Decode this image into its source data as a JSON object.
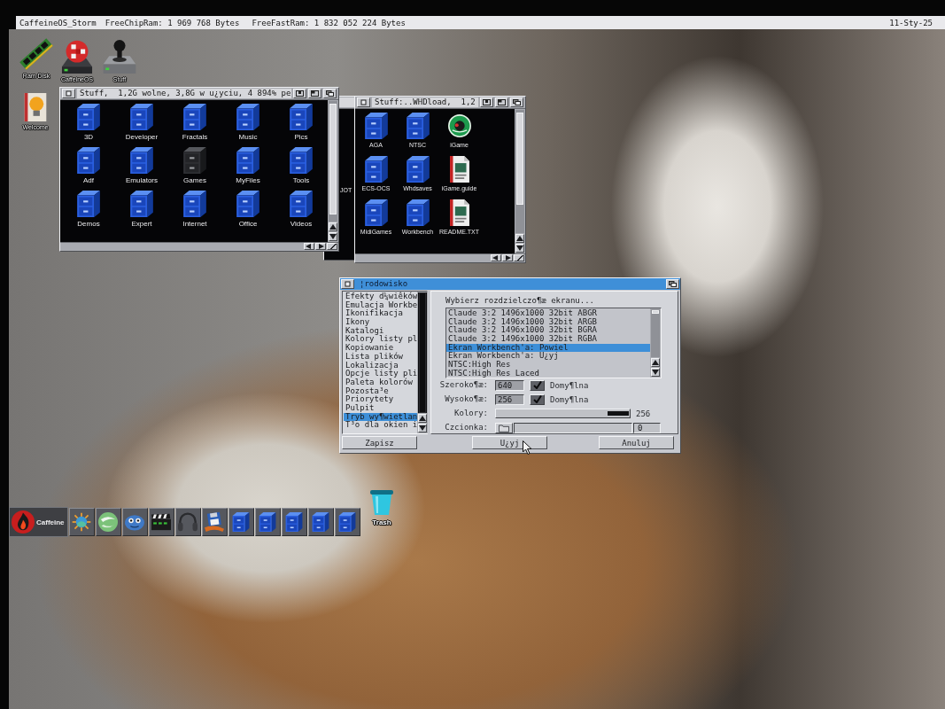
{
  "screen_bar": {
    "title": "CaffeineOS_Storm",
    "chip_ram": "FreeChipRam: 1 969 768 Bytes",
    "fast_ram": "FreeFastRam: 1 832 052 224 Bytes",
    "date": "11-Sty-25"
  },
  "desktop_icons": [
    {
      "label": "Ram Disk",
      "kind": "ram"
    },
    {
      "label": "CaffeineOS",
      "kind": "ball"
    },
    {
      "label": "Stuff",
      "kind": "joystick"
    },
    {
      "label": "Welcome",
      "kind": "bulb"
    }
  ],
  "windows": [
    {
      "title": "Stuff,  1,2G wolne, 3,8G w u¿yciu, 4 894% pe",
      "icons": [
        {
          "label": "3D",
          "kind": "drawer"
        },
        {
          "label": "Developer",
          "kind": "drawer"
        },
        {
          "label": "Fractals",
          "kind": "drawer"
        },
        {
          "label": "Music",
          "kind": "drawer"
        },
        {
          "label": "Pics",
          "kind": "drawer"
        },
        {
          "label": "Adf",
          "kind": "drawer"
        },
        {
          "label": "Emulators",
          "kind": "drawer"
        },
        {
          "label": "Games",
          "kind": "dark_drawer"
        },
        {
          "label": "MyFiles",
          "kind": "drawer"
        },
        {
          "label": "Tools",
          "kind": "drawer"
        },
        {
          "label": "Demos",
          "kind": "drawer"
        },
        {
          "label": "Expert",
          "kind": "drawer"
        },
        {
          "label": "Internet",
          "kind": "drawer"
        },
        {
          "label": "Office",
          "kind": "drawer"
        },
        {
          "label": "Videos",
          "kind": "drawer"
        }
      ]
    },
    {
      "title": "Stuff:..WHDload,  1,2",
      "icons": [
        {
          "label": "AGA",
          "kind": "drawer"
        },
        {
          "label": "NTSC",
          "kind": "drawer"
        },
        {
          "label": "iGame",
          "kind": "disc"
        },
        {
          "label": "ECS-OCS",
          "kind": "drawer"
        },
        {
          "label": "Whdsaves",
          "kind": "drawer"
        },
        {
          "label": "iGame.guide",
          "kind": "document"
        },
        {
          "label": "MidiGames",
          "kind": "drawer"
        },
        {
          "label": "Workbench",
          "kind": "drawer"
        },
        {
          "label": "README.TXT",
          "kind": "document"
        }
      ]
    }
  ],
  "background_window": {
    "icon_label": "JOT"
  },
  "dialog": {
    "title": "¦rodowisko",
    "categories": [
      {
        "label": "Efekty d¼wiêków",
        "selected": false
      },
      {
        "label": "Emulacja Workbe",
        "selected": false
      },
      {
        "label": "Ikonifikacja",
        "selected": false
      },
      {
        "label": "Ikony",
        "selected": false
      },
      {
        "label": "Katalogi",
        "selected": false
      },
      {
        "label": "Kolory listy pl",
        "selected": false
      },
      {
        "label": "Kopiowanie",
        "selected": false
      },
      {
        "label": "Lista plików",
        "selected": false
      },
      {
        "label": "Lokalizacja",
        "selected": false
      },
      {
        "label": "Opcje listy pli",
        "selected": false
      },
      {
        "label": "Paleta kolorów",
        "selected": false
      },
      {
        "label": "Pozosta³e",
        "selected": false
      },
      {
        "label": "Priorytety",
        "selected": false
      },
      {
        "label": "Pulpit",
        "selected": false
      },
      {
        "label": "Tryb wy¶wietlan",
        "selected": true
      },
      {
        "label": "T³o dla okien i",
        "selected": false
      }
    ],
    "prompt": "Wybierz rozdzielczo¶æ ekranu...",
    "modes": [
      {
        "label": "Claude 3:2 1496x1000 32bit ABGR",
        "selected": false
      },
      {
        "label": "Claude 3:2 1496x1000 32bit ARGB",
        "selected": false
      },
      {
        "label": "Claude 3:2 1496x1000 32bit BGRA",
        "selected": false
      },
      {
        "label": "Claude 3:2 1496x1000 32bit RGBA",
        "selected": false
      },
      {
        "label": "Ekran Workbench'a: Powiel",
        "selected": true
      },
      {
        "label": "Ekran Workbench'a: U¿yj",
        "selected": false
      },
      {
        "label": "NTSC:High Res",
        "selected": false
      },
      {
        "label": "NTSC:High Res Laced",
        "selected": false
      }
    ],
    "width": {
      "label": "Szeroko¶æ:",
      "value": "640",
      "checked": true,
      "option": "Domy¶lna"
    },
    "height": {
      "label": "Wysoko¶æ:",
      "value": "256",
      "checked": true,
      "option": "Domy¶lna"
    },
    "colors": {
      "label": "Kolory:",
      "level": 1,
      "reading": "256"
    },
    "font": {
      "label": "Czcionka:",
      "size": "0"
    },
    "buttons": [
      {
        "label": "Zapisz"
      },
      {
        "label": "U¿yj"
      },
      {
        "label": "Anuluj"
      }
    ]
  },
  "dock": {
    "launcher": {
      "label": "Caffeine"
    },
    "items": [
      {
        "kind": "sun"
      },
      {
        "kind": "sphere"
      },
      {
        "kind": "creature"
      },
      {
        "kind": "clapperboard"
      },
      {
        "kind": "headphones"
      },
      {
        "kind": "floppy"
      },
      {
        "kind": "drawer"
      },
      {
        "kind": "drawer"
      },
      {
        "kind": "drawer"
      },
      {
        "kind": "drawer"
      },
      {
        "kind": "drawer"
      }
    ]
  },
  "trash": {
    "label": "Trash"
  }
}
